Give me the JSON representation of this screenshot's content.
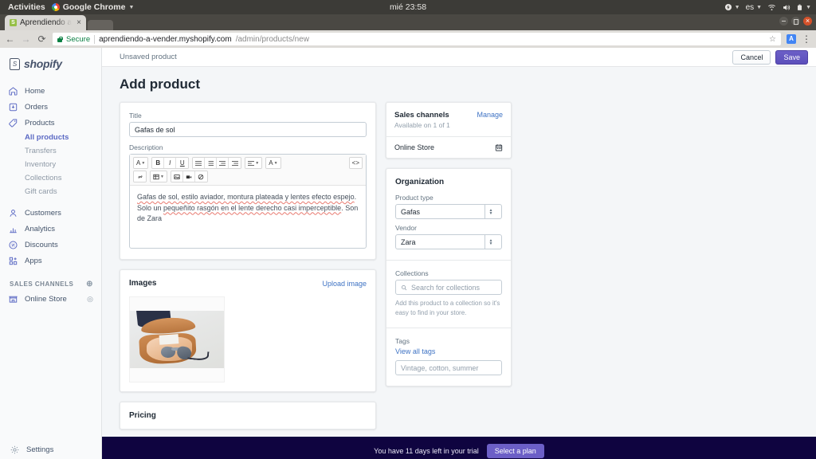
{
  "os": {
    "activities": "Activities",
    "app_menu": "Google Chrome",
    "clock": "mié 23:58",
    "tray": {
      "power_icon": "power-icon",
      "keyboard_layout": "es",
      "wifi_icon": "wifi-icon",
      "volume_icon": "volume-icon",
      "battery_icon": "battery-icon"
    }
  },
  "browser": {
    "tab_title": "Aprendiendo a",
    "tab_close_icon": "close-icon",
    "favicon": "shopify-favicon",
    "back_icon": "back-arrow-icon",
    "forward_icon": "forward-arrow-icon",
    "reload_icon": "reload-icon",
    "secure_label": "Secure",
    "lock_icon": "lock-icon",
    "url_main": "aprendiendo-a-vender.myshopify.com",
    "url_path": "/admin/products/new",
    "star_icon": "bookmark-star-icon",
    "extension_icon": "translate-extension-icon",
    "menu_icon": "kebab-menu-icon",
    "minimize_icon": "minimize-icon",
    "maximize_icon": "maximize-icon",
    "close_icon": "window-close-icon"
  },
  "sidebar": {
    "brand": "shopify",
    "items": [
      {
        "label": "Home",
        "icon": "home-icon"
      },
      {
        "label": "Orders",
        "icon": "orders-icon"
      },
      {
        "label": "Products",
        "icon": "tag-icon"
      }
    ],
    "product_subitems": [
      {
        "label": "All products",
        "active": true
      },
      {
        "label": "Transfers",
        "active": false
      },
      {
        "label": "Inventory",
        "active": false
      },
      {
        "label": "Collections",
        "active": false
      },
      {
        "label": "Gift cards",
        "active": false
      }
    ],
    "items2": [
      {
        "label": "Customers",
        "icon": "person-icon"
      },
      {
        "label": "Analytics",
        "icon": "bar-chart-icon"
      },
      {
        "label": "Discounts",
        "icon": "discount-icon"
      },
      {
        "label": "Apps",
        "icon": "apps-icon"
      }
    ],
    "sales_channels_heading": "SALES CHANNELS",
    "add_channel_icon": "plus-circle-icon",
    "online_store": "Online Store",
    "online_store_icon": "storefront-icon",
    "view_store_icon": "eye-icon",
    "settings": "Settings",
    "settings_icon": "gear-icon"
  },
  "topbar": {
    "title": "Unsaved product",
    "cancel_label": "Cancel",
    "save_label": "Save"
  },
  "page": {
    "heading": "Add product"
  },
  "product": {
    "title_label": "Title",
    "title_value": "Gafas de sol",
    "description_label": "Description",
    "description_part1": "Gafas de sol, estilo aviador, montura plateada y lentes efecto espejo",
    "description_part2": ". Solo un ",
    "description_part3": "pequeñito rasgón en el lente derecho casi imperceptible",
    "description_part4": ". Son de Zara"
  },
  "editor": {
    "row1": [
      {
        "icon": "font-style-icon",
        "glyph": "A",
        "caret": true
      },
      {
        "icon": "bold-icon",
        "glyph": "B",
        "caret": false
      },
      {
        "icon": "italic-icon",
        "glyph": "I",
        "caret": false
      },
      {
        "icon": "underline-icon",
        "glyph": "U",
        "caret": false
      }
    ],
    "row1_lists": [
      {
        "icon": "bullet-list-icon"
      },
      {
        "icon": "numbered-list-icon"
      },
      {
        "icon": "outdent-icon"
      },
      {
        "icon": "indent-icon"
      }
    ],
    "row1_align": {
      "icon": "align-icon",
      "caret": true
    },
    "row1_color": {
      "icon": "text-color-icon",
      "glyph": "A",
      "caret": true
    },
    "row1_code": {
      "icon": "code-view-icon",
      "glyph": "<>"
    },
    "row2": [
      {
        "icon": "link-icon"
      },
      {
        "icon": "table-icon",
        "caret": true
      },
      {
        "icon": "insert-image-icon"
      },
      {
        "icon": "insert-video-icon"
      },
      {
        "icon": "clear-formatting-icon"
      }
    ]
  },
  "images": {
    "title": "Images",
    "upload_link": "Upload image",
    "thumbnail_alt": "sunglasses-in-leather-case-photo"
  },
  "pricing": {
    "title": "Pricing"
  },
  "sales_channels": {
    "title": "Sales channels",
    "manage_link": "Manage",
    "subtitle": "Available on 1 of 1",
    "channel": "Online Store",
    "calendar_icon": "calendar-icon"
  },
  "organization": {
    "title": "Organization",
    "product_type_label": "Product type",
    "product_type_value": "Gafas",
    "vendor_label": "Vendor",
    "vendor_value": "Zara",
    "collections_label": "Collections",
    "collections_placeholder": "Search for collections",
    "collections_search_icon": "search-icon",
    "collections_helper": "Add this product to a collection so it's easy to find in your store.",
    "tags_label": "Tags",
    "view_all_tags": "View all tags",
    "tags_placeholder": "Vintage, cotton, summer"
  },
  "trial": {
    "message": "You have 11 days left in your trial",
    "button_label": "Select a plan"
  },
  "colors": {
    "accent": "#5c6ac4",
    "primary_button": "#6c5fc7",
    "link": "#3f73c4",
    "banner_bg": "#0f0440",
    "spellcheck": "#e8796f"
  }
}
